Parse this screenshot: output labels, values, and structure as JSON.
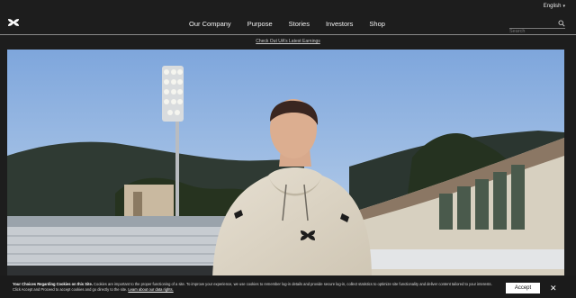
{
  "topbar": {
    "language": "English"
  },
  "nav": {
    "logo_icon": "under-armour-logo",
    "items": [
      {
        "label": "Our Company"
      },
      {
        "label": "Purpose"
      },
      {
        "label": "Stories"
      },
      {
        "label": "Investors"
      },
      {
        "label": "Shop"
      }
    ],
    "search_placeholder": "Search"
  },
  "promo": {
    "link_text": "Check Out UA's Latest Earnings"
  },
  "hero": {
    "alt": "Athlete in a cream hoodie standing in a stadium",
    "sky_color": "#8fb2df",
    "hoodie_color": "#ddd6c7"
  },
  "cookie_banner": {
    "heading": "Your Choices Regarding Cookies on this Site.",
    "body": "Cookies are important to the proper functioning of a site. To improve your experience, we use cookies to remember log-in details and provide secure log-in, collect statistics to optimize site functionality and deliver content tailored to your interests. Click Accept and Proceed to accept cookies and go directly to the site.",
    "link": "Learn about our data rights.",
    "accept_label": "Accept",
    "close_symbol": "✕"
  }
}
